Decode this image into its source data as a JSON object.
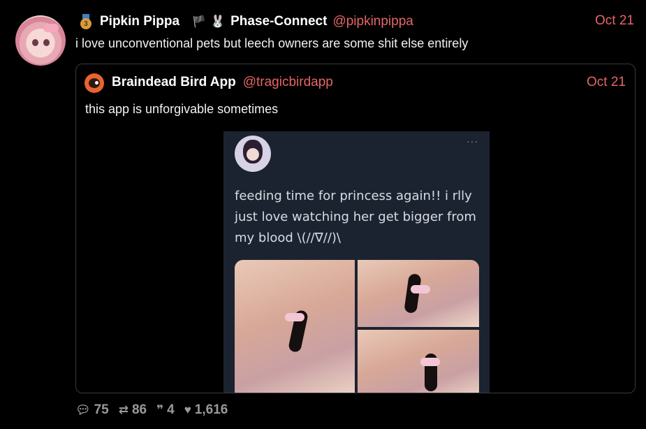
{
  "post": {
    "author_name": "Pipkin Pippa",
    "author_affix": "Phase-Connect",
    "handle": "@pipkinpippa",
    "date": "Oct 21",
    "medal_number": "3",
    "text": "i love unconventional pets but leech owners are some shit else entirely",
    "icons": [
      "medal-icon",
      "flag-icon",
      "bunny-icon"
    ]
  },
  "quote": {
    "author_name": "Braindead Bird App",
    "handle": "@tragicbirdapp",
    "date": "Oct 21",
    "text": "this app is unforgivable sometimes",
    "embedded_post": {
      "more_label": "···",
      "text": "feeding time for princess again!! i rlly just love watching her get bigger from my blood \\(//∇//)\\"
    }
  },
  "actions": {
    "replies": "75",
    "reposts": "86",
    "quotes": "4",
    "likes": "1,616"
  },
  "colors": {
    "background": "#000000",
    "accent": "#e66565",
    "muted": "#9a9a9a"
  }
}
